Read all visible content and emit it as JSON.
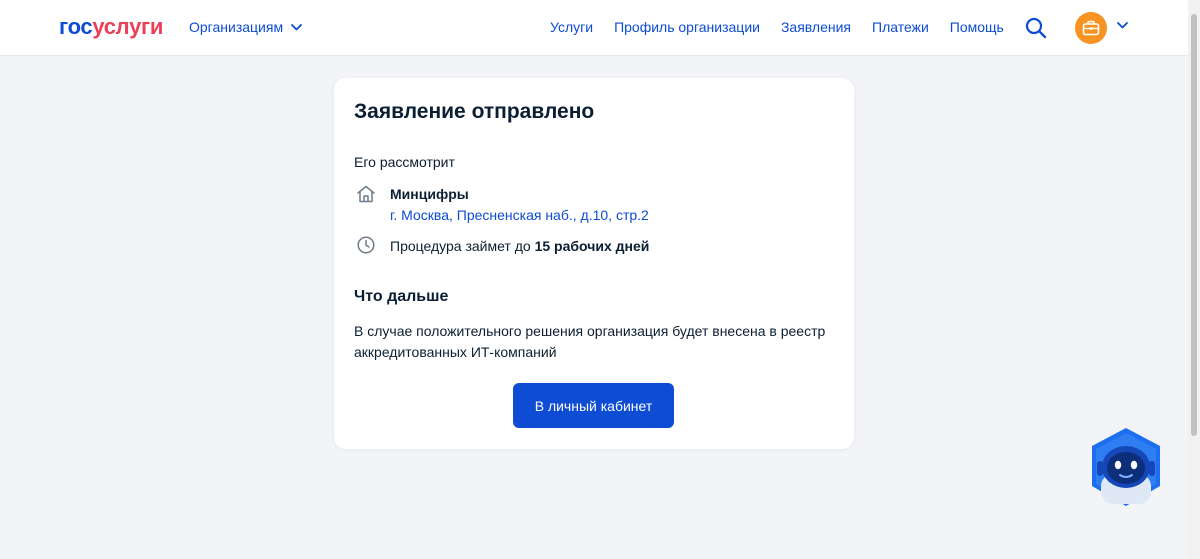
{
  "header": {
    "logo": {
      "part1": "гос",
      "part2": "услуги"
    },
    "org_menu": "Организациям",
    "nav": [
      "Услуги",
      "Профиль организации",
      "Заявления",
      "Платежи",
      "Помощь"
    ]
  },
  "card": {
    "title": "Заявление отправлено",
    "reviewer_caption": "Его рассмотрит",
    "org_name": "Минцифры",
    "org_address": "г. Москва, Пресненская наб., д.10, стр.2",
    "duration_prefix": "Процедура займет до ",
    "duration_value": "15 рабочих дней",
    "next_title": "Что дальше",
    "next_text": "В случае положительного решения организация будет внесена в реестр аккредитованных ИТ-компаний",
    "button": "В личный кабинет"
  },
  "icons": {
    "search": "search-icon",
    "avatar": "briefcase-icon",
    "org": "house-icon",
    "time": "clock-icon",
    "assistant": "robot-assistant-icon"
  },
  "colors": {
    "brand_blue": "#0d4cd3",
    "brand_red": "#ee3f58",
    "avatar_orange": "#f79320",
    "background": "#f2f4f7",
    "text": "#0b1f33"
  }
}
